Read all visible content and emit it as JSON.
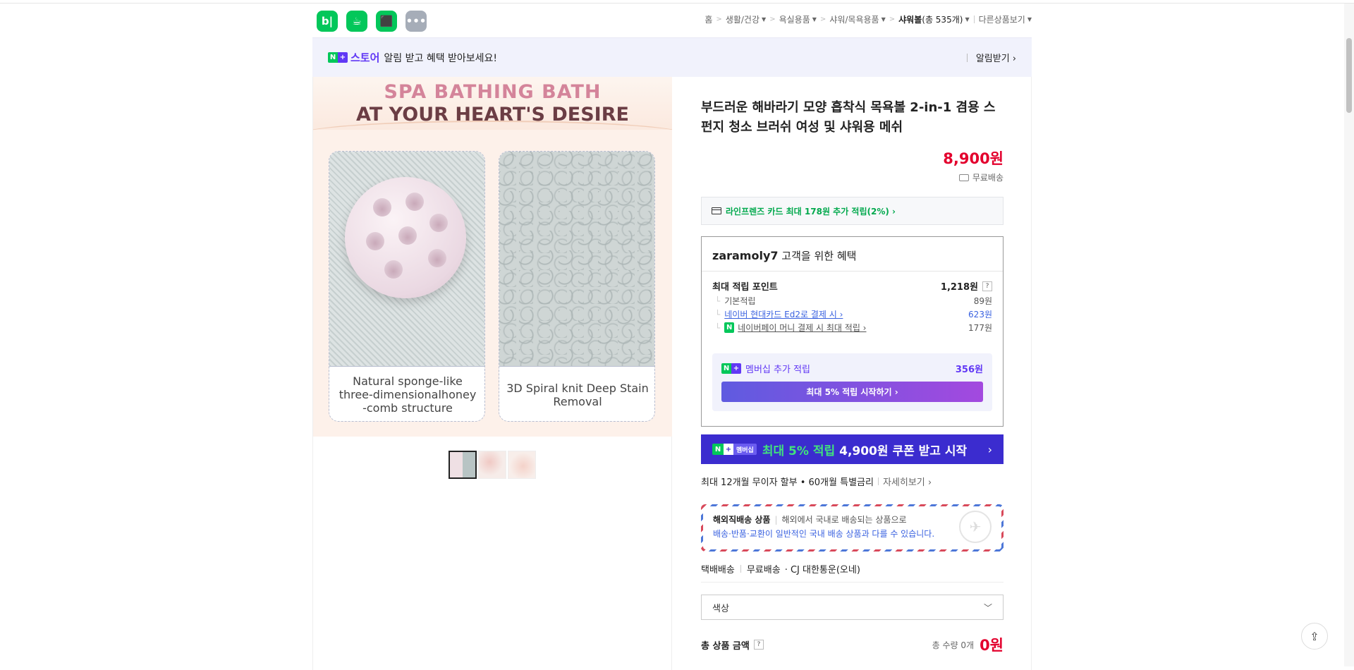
{
  "app_icons": [
    {
      "name": "blog-icon",
      "glyph": "b|",
      "color": "#03c75a"
    },
    {
      "name": "cafe-icon",
      "glyph": "☕",
      "color": "#03c75a"
    },
    {
      "name": "bookmark-icon",
      "glyph": "⬛",
      "color": "#03c75a"
    },
    {
      "name": "more-icon",
      "glyph": "•••",
      "color": "#a6adb8"
    }
  ],
  "breadcrumb": {
    "items": [
      "홈",
      "생활/건강",
      "욕실용품",
      "샤워/목욕용품"
    ],
    "current": "샤워볼",
    "count": "(총 535개)",
    "other": "다른상품보기"
  },
  "alert": {
    "store": "스토어",
    "message": "알림 받고 혜택 받아보세요!",
    "action": "알림받기 ›"
  },
  "hero": {
    "title1": "SPA BATHING BATH",
    "title2": "AT YOUR HEART'S DESIRE",
    "caption1": "Natural sponge-like three-dimensionalhoney -comb structure",
    "caption2": "3D Spiral knit Deep Stain Removal"
  },
  "product": {
    "title": "부드러운 해바라기 모양 흡착식 목욕볼 2-in-1 겸용 스펀지 청소 브러쉬 여성 및 샤워용 메쉬",
    "price": "8,900원",
    "shipping": "무료배송",
    "card_benefit": "라인프렌즈 카드 최대 178원 추가 적립(2%) ›"
  },
  "benefits": {
    "header_user": "zaramoly7",
    "header_rest": " 고객을 위한 혜택",
    "max_points_label": "최대 적립 포인트",
    "max_points_value": "1,218원",
    "rows": [
      {
        "label": "기본적립",
        "value": "89원"
      },
      {
        "label": "네이버 현대카드 Ed2로 결제 시 ›",
        "value": "623원"
      },
      {
        "label": "네이버페이 머니 결제 시 최대 적립 ›",
        "value": "177원"
      }
    ],
    "membership_label": "멤버십 추가 적립",
    "membership_value": "356원",
    "membership_button": "최대 5% 적립 시작하기 ›"
  },
  "membership_banner": {
    "chip": "멤버십",
    "green": "최대 5% 적립",
    "white": "4,900원 쿠폰 받고 시작",
    "arrow": "›"
  },
  "installment": {
    "text": "최대 12개월 무이자 할부 • 60개월 특별금리",
    "more": "자세히보기 ›"
  },
  "overseas": {
    "title": "해외직배송 상품",
    "desc": "해외에서 국내로 배송되는 상품으로",
    "line2": "배송·반품·교환이 일반적인 국내 배송 상품과 다를 수 있습니다."
  },
  "delivery": {
    "type": "택배배송",
    "fee": "무료배송",
    "carrier": "· CJ 대한통운(오네)"
  },
  "option_select": {
    "label": "색상"
  },
  "total": {
    "label": "총 상품 금액",
    "qty": "총 수량 0개",
    "price": "0원"
  },
  "colors": {
    "accent_green": "#03c75a",
    "price_red": "#e3002d",
    "membership_purple": "#6138f5"
  }
}
